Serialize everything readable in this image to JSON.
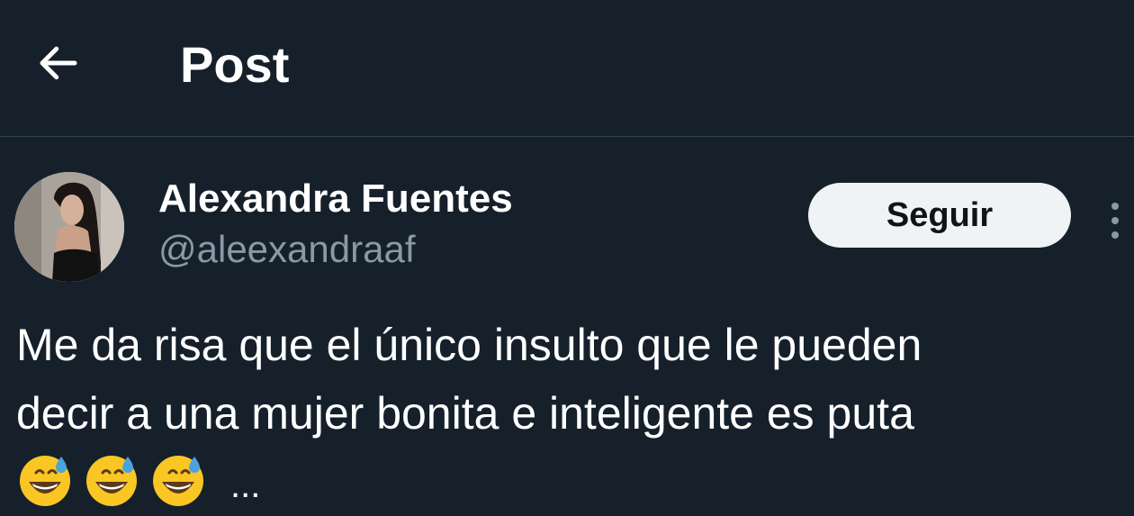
{
  "header": {
    "title": "Post",
    "back_icon": "arrow-left-icon"
  },
  "post": {
    "author": {
      "display_name": "Alexandra Fuentes",
      "handle": "@aleexandraaf"
    },
    "follow_label": "Seguir",
    "more_icon": "more-vertical-icon",
    "text_lines": [
      "Me da risa que el único insulto que le pueden",
      "decir a una mujer bonita e inteligente es puta"
    ],
    "emojis": [
      "grinning-face-with-sweat",
      "grinning-face-with-sweat",
      "grinning-face-with-sweat"
    ],
    "truncation": "..."
  },
  "colors": {
    "background": "#15202b",
    "divider": "#38444d",
    "text_primary": "#ffffff",
    "text_secondary": "#8b98a5",
    "follow_button_bg": "#eff3f4",
    "follow_button_text": "#0f1419"
  }
}
